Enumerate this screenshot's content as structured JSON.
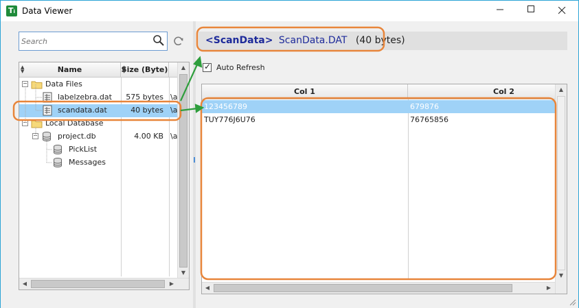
{
  "window": {
    "title": "Data Viewer",
    "icon_letter": "T",
    "icon_sub": "i",
    "buttons": [
      "minimize-icon",
      "maximize-icon",
      "close-icon"
    ]
  },
  "search": {
    "placeholder": "Search",
    "value": ""
  },
  "tree": {
    "columns": {
      "name": "Name",
      "size": "Size (Byte)"
    },
    "rows": [
      {
        "label": "Data Files",
        "size": "",
        "path": "",
        "icon": "folder-icon",
        "expander": "−"
      },
      {
        "label": "labelzebra.dat",
        "size": "575 bytes",
        "path": "\\a",
        "icon": "data-file-icon"
      },
      {
        "label": "scandata.dat",
        "size": "40 bytes",
        "path": "\\a",
        "icon": "data-file-icon",
        "selected": true
      },
      {
        "label": "Local Database",
        "size": "",
        "path": "",
        "icon": "folder-icon",
        "expander": "−"
      },
      {
        "label": "project.db",
        "size": "4.00 KB",
        "path": "\\a",
        "icon": "database-icon",
        "expander": "−"
      },
      {
        "label": "PickList",
        "size": "",
        "path": "",
        "icon": "table-icon"
      },
      {
        "label": "Messages",
        "size": "",
        "path": "",
        "icon": "table-icon"
      }
    ]
  },
  "header": {
    "tag": "<ScanData>",
    "filename": "ScanData.DAT",
    "size": "(40 bytes)"
  },
  "auto_refresh": {
    "label": "Auto Refresh",
    "checked": true
  },
  "grid": {
    "columns": [
      "Col 1",
      "Col 2"
    ],
    "rows": [
      [
        "123456789",
        "679876"
      ],
      [
        "TUY776J6U76",
        "76765856"
      ]
    ],
    "selected_row": 0
  },
  "colors": {
    "accent": "#2aa3d6",
    "selection": "#9fd2f7",
    "annotation": "#e8853a",
    "arrow": "#2e9e3c",
    "header_text": "#1d2a9a"
  }
}
